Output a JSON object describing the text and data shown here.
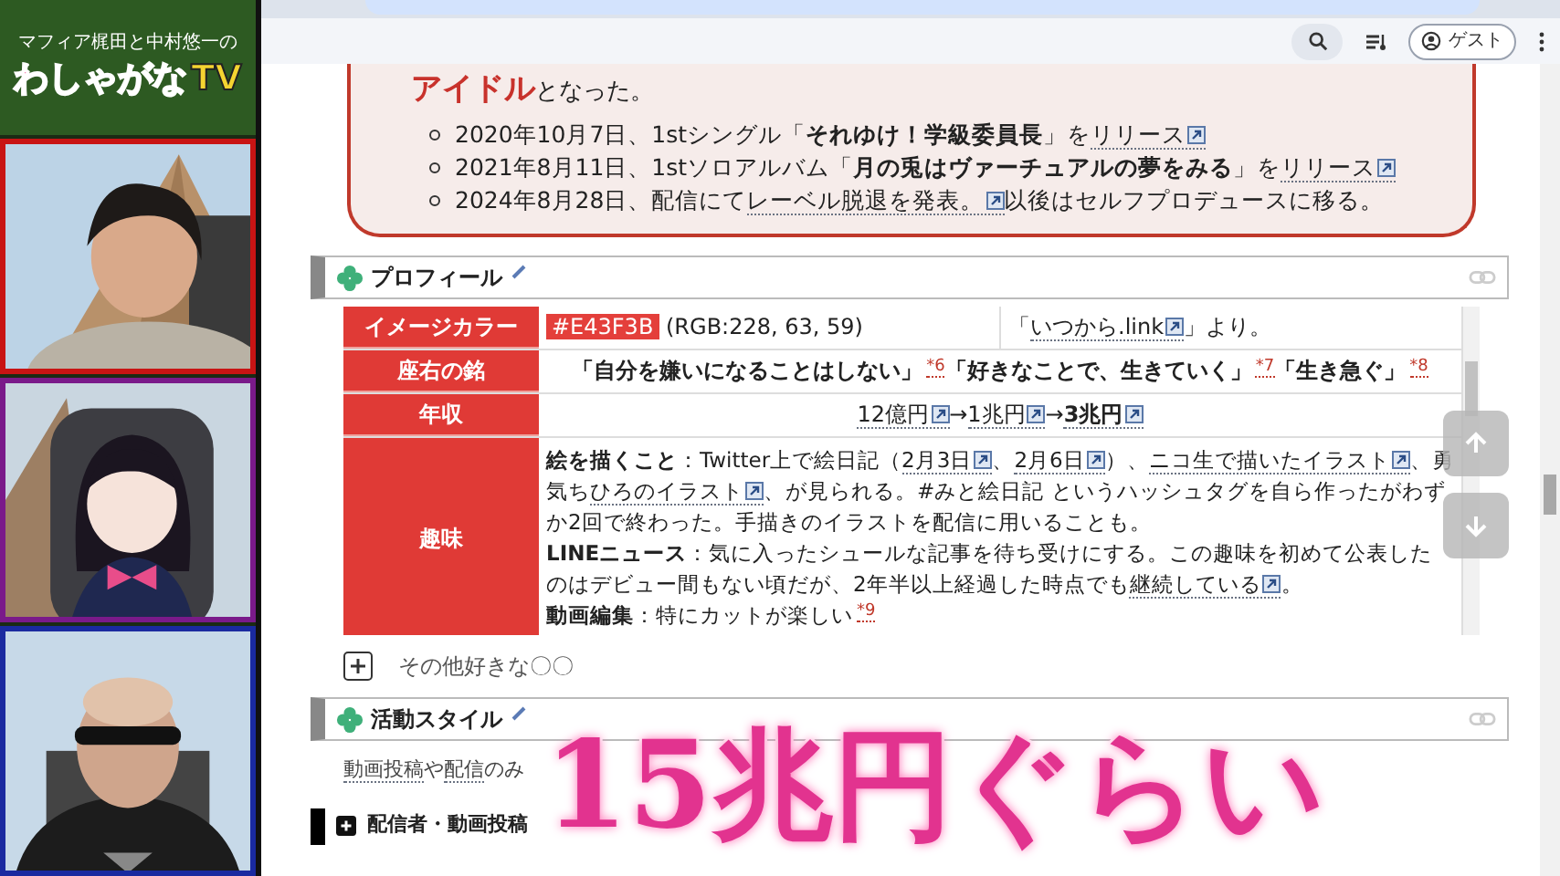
{
  "stream": {
    "logo": {
      "subtitle": "マフィア梶田と中村悠一の",
      "title": "わしゃがな",
      "title_tail": "TV"
    }
  },
  "browser": {
    "account_button": "ゲスト"
  },
  "page": {
    "intro": [
      {
        "kind": "emph",
        "text": "アイドル"
      },
      {
        "kind": "plain",
        "text": "となった。"
      }
    ],
    "history": [
      [
        {
          "kind": "plain",
          "text": "2020年10月7日、1stシングル「"
        },
        {
          "kind": "bold",
          "text": "それゆけ！学級委員長"
        },
        {
          "kind": "plain",
          "text": "」を"
        },
        {
          "kind": "extlink",
          "text": "リリース"
        }
      ],
      [
        {
          "kind": "plain",
          "text": "2021年8月11日、1stソロアルバム「"
        },
        {
          "kind": "bold",
          "text": "月の兎はヴァーチュアルの夢をみる"
        },
        {
          "kind": "plain",
          "text": "」を"
        },
        {
          "kind": "extlink",
          "text": "リリース"
        }
      ],
      [
        {
          "kind": "plain",
          "text": "2024年8月28日、配信にて"
        },
        {
          "kind": "extlink",
          "text": "レーベル脱退を発表。"
        },
        {
          "kind": "plain",
          "text": "以後はセルフプロデュースに移る。"
        }
      ]
    ],
    "profile": {
      "title": "プロフィール",
      "rows": [
        {
          "label": "イメージカラー",
          "cells": [
            {
              "paragraphs": [
                [
                  {
                    "kind": "swatch",
                    "text": "#E43F3B",
                    "color": "#e43f3b"
                  },
                  {
                    "kind": "plain",
                    "text": " (RGB:228, 63, 59)"
                  }
                ]
              ]
            },
            {
              "paragraphs": [
                [
                  {
                    "kind": "plain",
                    "text": "「"
                  },
                  {
                    "kind": "extlink",
                    "text": "いつから.link"
                  },
                  {
                    "kind": "plain",
                    "text": "」より。"
                  }
                ]
              ]
            }
          ]
        },
        {
          "label": "座右の銘",
          "cells": [
            {
              "paragraphs": [
                [
                  {
                    "kind": "bold",
                    "text": "「自分を嫌いになることはしない」"
                  },
                  {
                    "kind": "note",
                    "text": "*6"
                  },
                  {
                    "kind": "bold",
                    "text": "「好きなことで、生きていく」"
                  },
                  {
                    "kind": "note",
                    "text": "*7"
                  },
                  {
                    "kind": "bold",
                    "text": "「生き急ぐ」"
                  },
                  {
                    "kind": "note",
                    "text": "*8"
                  }
                ]
              ]
            }
          ]
        },
        {
          "label": "年収",
          "cells": [
            {
              "paragraphs": [
                [
                  {
                    "kind": "extlink",
                    "text": "12億円"
                  },
                  {
                    "kind": "plain",
                    "text": "→"
                  },
                  {
                    "kind": "extlink",
                    "text": "1兆円"
                  },
                  {
                    "kind": "plain",
                    "text": "→"
                  },
                  {
                    "kind": "strong_extlink",
                    "text": "3兆円"
                  }
                ]
              ]
            }
          ]
        },
        {
          "label": "趣味",
          "cells": [
            {
              "paragraphs": [
                [
                  {
                    "kind": "bold",
                    "text": "絵を描くこと"
                  },
                  {
                    "kind": "plain",
                    "text": "：Twitter上で絵日記（"
                  },
                  {
                    "kind": "extlink",
                    "text": "2月3日"
                  },
                  {
                    "kind": "plain",
                    "text": "、"
                  },
                  {
                    "kind": "extlink",
                    "text": "2月6日"
                  },
                  {
                    "kind": "plain",
                    "text": "）、"
                  },
                  {
                    "kind": "extlink",
                    "text": "ニコ生で描いたイラスト"
                  },
                  {
                    "kind": "plain",
                    "text": "、勇気ち"
                  },
                  {
                    "kind": "extlink",
                    "text": "ひろのイラスト"
                  },
                  {
                    "kind": "plain",
                    "text": "、が見られる。#みと絵日記 というハッシュタグを自ら作ったがわずか2回で終わった。手描きのイラストを配信に用いることも。"
                  }
                ],
                [
                  {
                    "kind": "bold",
                    "text": "LINEニュース"
                  },
                  {
                    "kind": "plain",
                    "text": "：気に入ったシュールな記事を待ち受けにする。この趣味を初めて公表したのはデビュー間もない頃だが、2年半以上経過した時点でも"
                  },
                  {
                    "kind": "extlink",
                    "text": "継続している"
                  },
                  {
                    "kind": "plain",
                    "text": "。"
                  }
                ],
                [
                  {
                    "kind": "bold",
                    "text": "動画編集"
                  },
                  {
                    "kind": "plain",
                    "text": "：特にカットが楽しい"
                  },
                  {
                    "kind": "note",
                    "text": "*9"
                  }
                ]
              ]
            }
          ]
        }
      ]
    },
    "more": {
      "label": "その他好きな〇〇",
      "expanded": false
    },
    "activity": {
      "title": "活動スタイル",
      "text": [
        {
          "kind": "link",
          "text": "動画投稿"
        },
        {
          "kind": "plain",
          "text": "や"
        },
        {
          "kind": "link",
          "text": "配信"
        },
        {
          "kind": "plain",
          "text": "のみ"
        }
      ]
    },
    "next_section": {
      "title": "配信者・動画投稿"
    }
  },
  "caption": "15兆円ぐらい"
}
